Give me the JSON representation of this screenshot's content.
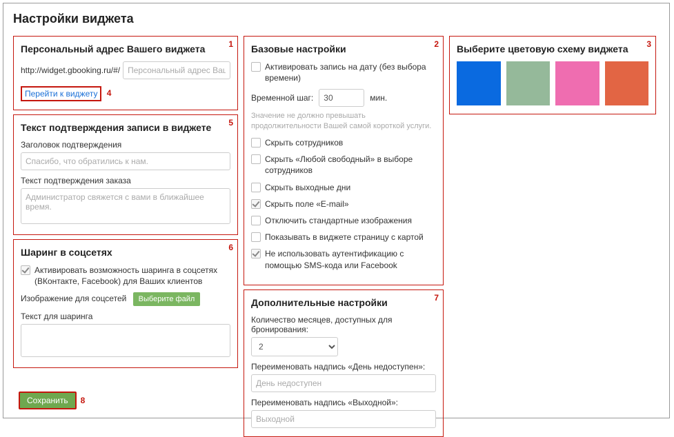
{
  "page": {
    "title": "Настройки виджета"
  },
  "panel1": {
    "num": "1",
    "title": "Персональный адрес Вашего виджета",
    "prefix": "http://widget.gbooking.ru/#/",
    "placeholder": "Персональный адрес Ваш",
    "link_label": "Перейти к виджету",
    "link_num": "4"
  },
  "panel5": {
    "num": "5",
    "title": "Текст подтверждения записи в виджете",
    "heading_label": "Заголовок подтверждения",
    "heading_placeholder": "Спасибо, что обратились к нам.",
    "body_label": "Текст подтверждения заказа",
    "body_placeholder": "Администратор свяжется с вами в ближайшее время."
  },
  "panel6": {
    "num": "6",
    "title": "Шаринг в соцсетях",
    "enable_label": "Активировать возможность шаринга в соцсетях (ВКонтакте, Facebook) для Ваших клиентов",
    "enable_checked": true,
    "image_label": "Изображение для соцсетей",
    "file_button": "Выберите файл",
    "text_label": "Текст для шаринга"
  },
  "panel2": {
    "num": "2",
    "title": "Базовые настройки",
    "checkboxes": [
      {
        "label": "Активировать запись на дату (без выбора времени)",
        "checked": false
      }
    ],
    "step_label": "Временной шаг:",
    "step_value": "30",
    "step_unit": "мин.",
    "hint": "Значение не должно превышать продолжительности Вашей самой короткой услуги.",
    "checkboxes2": [
      {
        "label": "Скрыть сотрудников",
        "checked": false
      },
      {
        "label": "Скрыть «Любой свободный» в выборе сотрудников",
        "checked": false
      },
      {
        "label": "Скрыть выходные дни",
        "checked": false
      },
      {
        "label": "Скрыть поле «E-mail»",
        "checked": true
      },
      {
        "label": "Отключить стандартные изображения",
        "checked": false
      },
      {
        "label": "Показывать в виджете страницу с картой",
        "checked": false
      },
      {
        "label": "Не использовать аутентификацию с помощью SMS-кода или Facebook",
        "checked": true
      }
    ]
  },
  "panel7": {
    "num": "7",
    "title": "Дополнительные настройки",
    "months_label": "Количество месяцев, доступных для бронирования:",
    "months_value": "2",
    "rename_unavail_label": "Переименовать надпись «День недоступен»:",
    "rename_unavail_placeholder": "День недоступен",
    "rename_holiday_label": "Переименовать надпись «Выходной»:",
    "rename_holiday_placeholder": "Выходной"
  },
  "panel3": {
    "num": "3",
    "title": "Выберите цветовую схему виджета",
    "colors": [
      "#0a6ae0",
      "#95b99a",
      "#ef6db0",
      "#e26544"
    ]
  },
  "save": {
    "label": "Сохранить",
    "num": "8"
  }
}
